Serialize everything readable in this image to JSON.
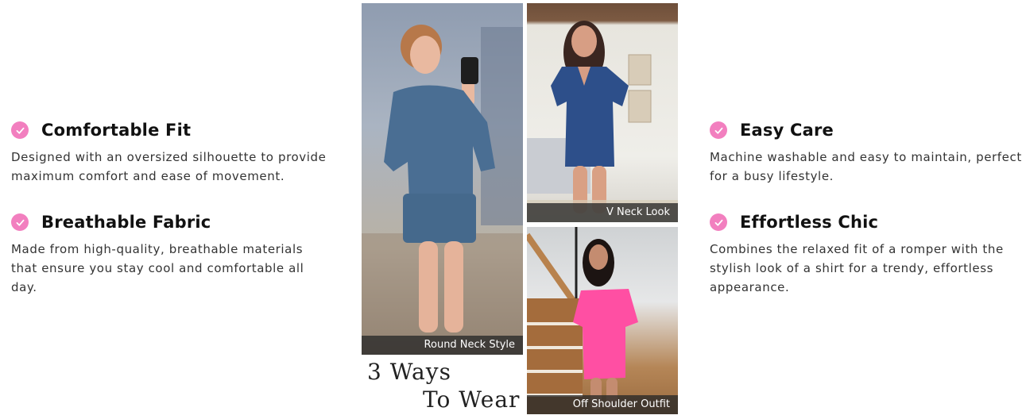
{
  "features": {
    "comfortable_fit": {
      "title": "Comfortable Fit",
      "description": "Designed with an oversized silhouette to provide maximum comfort and ease of movement."
    },
    "breathable_fabric": {
      "title": "Breathable Fabric",
      "description": "Made from high-quality, breathable materials that ensure you stay cool and comfortable all day."
    },
    "easy_care": {
      "title": "Easy Care",
      "description": "Machine washable and easy to maintain, perfect for a busy lifestyle."
    },
    "effortless_chic": {
      "title": "Effortless Chic",
      "description": "Combines the relaxed fit of a romper with the stylish look of a shirt for a trendy, effortless appearance."
    }
  },
  "gallery": {
    "round_neck_caption": "Round Neck Style",
    "v_neck_caption": "V Neck Look",
    "off_shoulder_caption": "Off Shoulder Outfit",
    "heading_line1": "3 Ways",
    "heading_line2": "To Wear"
  },
  "colors": {
    "accent": "#f27fbf",
    "round_neck_romper": "#4a6e93",
    "v_neck_romper": "#2d4f8a",
    "off_shoulder_dress": "#ff4fa3"
  },
  "icons": {
    "bullet": "check-icon"
  }
}
